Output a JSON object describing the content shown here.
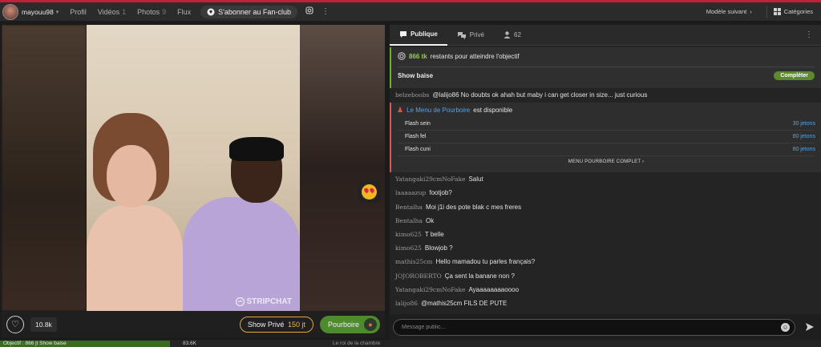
{
  "topbar": {
    "username": "mayouu98",
    "nav": [
      {
        "label": "Profil",
        "count": ""
      },
      {
        "label": "Vidéos",
        "count": "1"
      },
      {
        "label": "Photos",
        "count": "9"
      },
      {
        "label": "Flux",
        "count": ""
      }
    ],
    "fanclub_label": "S'abonner au Fan-club",
    "next_model_label": "Modèle suivant",
    "categories_label": "Catégories"
  },
  "video": {
    "watermark": "STRIPCHAT"
  },
  "controls": {
    "likes": "10.8k",
    "show_prive_label": "Show Privé",
    "show_prive_price": "150 jt",
    "pourboire_label": "Pourboire"
  },
  "bottom": {
    "goal_progress_text": "Objectif : 866 jt Show baise",
    "goal_count": "83.6K",
    "right_text": "Le roi de la chambre",
    "goal_progress_fraction": 0.45
  },
  "chat": {
    "tabs": [
      {
        "label": "Publique"
      },
      {
        "label": "Privé"
      },
      {
        "label": "62"
      }
    ],
    "goal": {
      "tk": "866 tk",
      "remaining_text": "restants pour atteindre l'objectif",
      "name": "Show baise",
      "complete_label": "Compléter"
    },
    "msg_top": {
      "user": "belzeboobs",
      "text": "@lalijo86  No doubts ok ahah but maby i can get closer in size... just curious"
    },
    "menu": {
      "link_text": "Le Menu de Pourboire",
      "rest_text": "est disponible",
      "items": [
        {
          "name": "Flash sein",
          "price": "30 jetons"
        },
        {
          "name": "Flash fel",
          "price": "80 jetons"
        },
        {
          "name": "Flash cuni",
          "price": "80 jetons"
        }
      ],
      "full_label": "MENU POURBOIRE COMPLET"
    },
    "messages": [
      {
        "user": "Yatangaki29cmNoFake",
        "text": "Salut"
      },
      {
        "user": "laaaaazup",
        "text": "footjob?"
      },
      {
        "user": "Bentalha",
        "text": "Moi j1i des pote blak c mes freres"
      },
      {
        "user": "Bentalha",
        "text": "Ok"
      },
      {
        "user": "kimo625",
        "text": "T belle"
      },
      {
        "user": "kimo625",
        "text": "Blowjob ?"
      },
      {
        "user": "mathis25cm",
        "text": "Hello mamadou tu parles français?"
      },
      {
        "user": "JOJOROBERTO",
        "text": "Ça sent la banane non ?"
      },
      {
        "user": "Yatangaki29cmNoFake",
        "text": "Ayaaaaaaaaoooo"
      },
      {
        "user": "lalijo86",
        "text": "@mathis25cm  FILS DE PUTE"
      }
    ],
    "input_placeholder": "Message public..."
  },
  "colors": {
    "accent_red": "#c41e3a",
    "goal_green": "#6fb031",
    "link_blue": "#5aa1e0",
    "price_gold": "#f0b840"
  }
}
